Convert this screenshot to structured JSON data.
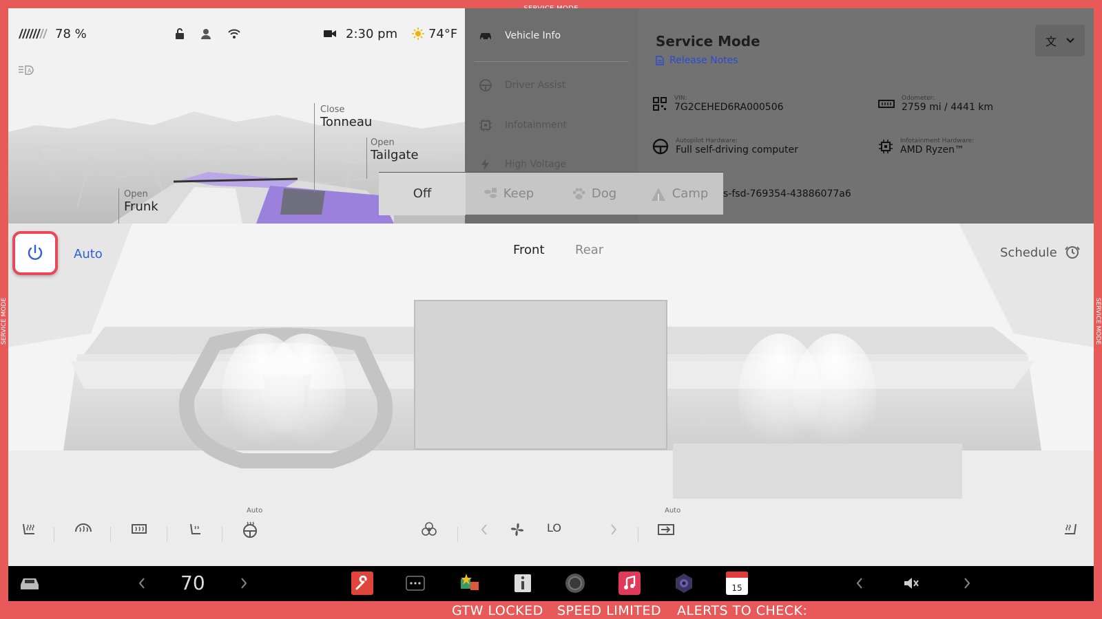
{
  "frame": {
    "label": "SERVICE MODE"
  },
  "status": {
    "battery_percent": "78 %",
    "time": "2:30 pm",
    "temperature": "74°F"
  },
  "vehicle": {
    "tonneau": {
      "action": "Close",
      "name": "Tonneau"
    },
    "tailgate": {
      "action": "Open",
      "name": "Tailgate"
    },
    "frunk": {
      "action": "Open",
      "name": "Frunk"
    }
  },
  "service_menu": {
    "items": [
      {
        "label": "Vehicle Info",
        "icon": "car-icon"
      },
      {
        "label": "Driver Assist",
        "icon": "steering-wheel-icon"
      },
      {
        "label": "Infotainment",
        "icon": "chip-icon"
      },
      {
        "label": "High Voltage",
        "icon": "lightning-icon"
      }
    ]
  },
  "service": {
    "title": "Service Mode",
    "release_notes": "Release Notes",
    "vin": {
      "label": "VIN:",
      "value": "7G2CEHED6RA000506"
    },
    "odometer": {
      "label": "Odometer:",
      "value": "2759 mi / 4441 km"
    },
    "autopilot": {
      "label": "Autopilot Hardware:",
      "value": "Full self-driving computer"
    },
    "infotainment": {
      "label": "Infotainment Hardware:",
      "value": "AMD Ryzen™"
    },
    "firmware_partial": "s-fsd-769354-43886077a6"
  },
  "modes": {
    "options": [
      "Off",
      "Keep",
      "Dog",
      "Camp"
    ],
    "selected": "Off"
  },
  "climate": {
    "auto_label": "Auto",
    "tabs": [
      "Front",
      "Rear"
    ],
    "active_tab": "Front",
    "schedule": "Schedule",
    "fan_level": "LO",
    "auto_small_1": "Auto",
    "auto_small_2": "Auto"
  },
  "dock": {
    "speed": "70",
    "calendar_day": "15"
  },
  "alerts": {
    "items": [
      "GTW LOCKED",
      "SPEED LIMITED",
      "ALERTS TO CHECK:"
    ]
  },
  "colors": {
    "service_frame": "#e85a5a",
    "accent_blue": "#2f5fd5",
    "power_border": "#e8485a"
  }
}
